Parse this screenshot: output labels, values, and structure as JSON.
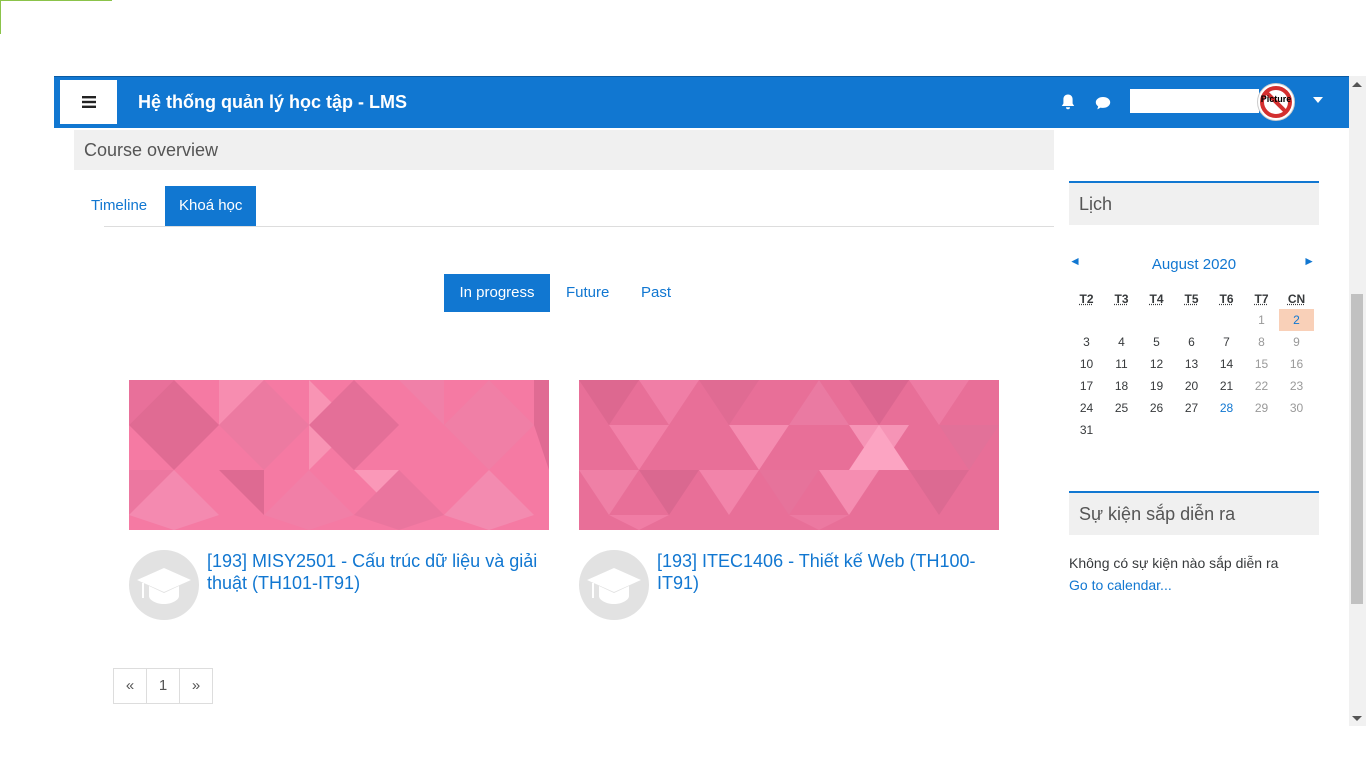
{
  "navbar": {
    "title": "Hệ thống quản lý học tập - LMS",
    "avatar_label": "Picture",
    "brand_color": "#1177d1"
  },
  "course_overview": {
    "header": "Course overview",
    "tabs": [
      "Timeline",
      "Khoá học"
    ],
    "active_tab": "Khoá học",
    "filters": [
      "In progress",
      "Future",
      "Past"
    ],
    "active_filter": "In progress",
    "courses": [
      {
        "name": "[193] MISY2501 - Cấu trúc dữ liệu và giải thuật (TH101-IT91)"
      },
      {
        "name": "[193] ITEC1406 - Thiết kế Web (TH100-IT91)"
      }
    ],
    "pagination": [
      "«",
      "1",
      "»"
    ]
  },
  "calendar": {
    "header": "Lịch",
    "month": "August 2020",
    "prev_icon": "◄",
    "next_icon": "►",
    "weekdays": [
      "T2",
      "T3",
      "T4",
      "T5",
      "T6",
      "T7",
      "CN"
    ],
    "today": "2",
    "event_day": "28",
    "weeks": [
      [
        "",
        "",
        "",
        "",
        "",
        "1",
        "2"
      ],
      [
        "3",
        "4",
        "5",
        "6",
        "7",
        "8",
        "9"
      ],
      [
        "10",
        "11",
        "12",
        "13",
        "14",
        "15",
        "16"
      ],
      [
        "17",
        "18",
        "19",
        "20",
        "21",
        "22",
        "23"
      ],
      [
        "24",
        "25",
        "26",
        "27",
        "28",
        "29",
        "30"
      ],
      [
        "31",
        "",
        "",
        "",
        "",
        "",
        ""
      ]
    ]
  },
  "upcoming_events": {
    "header": "Sự kiện sắp diễn ra",
    "empty_text": "Không có sự kiện nào sắp diễn ra",
    "calendar_link": "Go to calendar..."
  }
}
